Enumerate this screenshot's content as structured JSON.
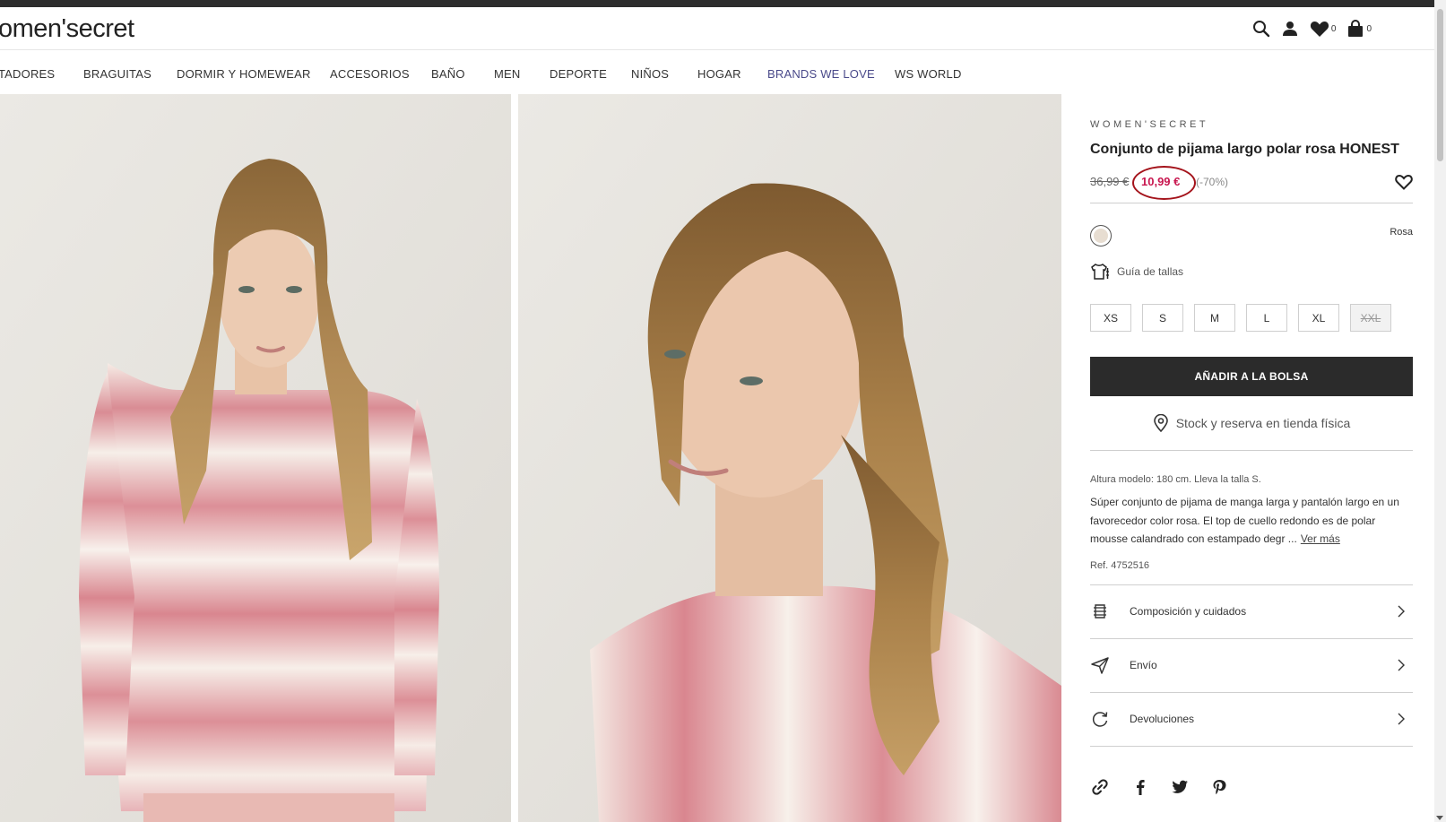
{
  "header": {
    "logo_text": "omen'secret",
    "wishlist_count": "0",
    "cart_count": "0"
  },
  "nav": {
    "items": [
      "TADORES",
      "BRAGUITAS",
      "DORMIR Y HOMEWEAR",
      "ACCESORIOS",
      "BAÑO",
      "MEN",
      "DEPORTE",
      "NIÑOS",
      "HOGAR",
      "BRANDS WE LOVE",
      "WS WORLD"
    ]
  },
  "product": {
    "brand": "WOMEN'SECRET",
    "title": "Conjunto de pijama largo polar rosa HONEST",
    "old_price": "36,99 €",
    "new_price": "10,99 €",
    "discount": "(-70%)",
    "color_name": "Rosa",
    "size_guide": "Guía de tallas",
    "sizes": [
      "XS",
      "S",
      "M",
      "L",
      "XL",
      "XXL"
    ],
    "add_to_bag": "AÑADIR A LA BOLSA",
    "stock_link": "Stock y reserva en tienda física",
    "model_info": "Altura modelo: 180 cm.  Lleva la talla S.",
    "description": "Súper conjunto de pijama de manga larga y pantalón largo en un favorecedor color rosa. El top de cuello redondo es de polar mousse calandrado con estampado degr ...",
    "read_more": "Ver más",
    "ref": "Ref. 4752516"
  },
  "accordion": {
    "composition": "Composición y cuidados",
    "shipping": "Envío",
    "returns": "Devoluciones"
  },
  "colors": {
    "accent_price": "#c8174f",
    "annotation_circle": "#a4131b",
    "button_bg": "#2b2b2b"
  }
}
